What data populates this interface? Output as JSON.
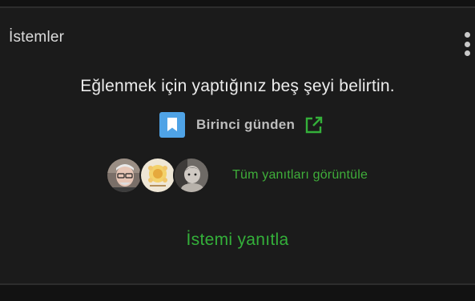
{
  "section": {
    "title": "İstemler"
  },
  "prompt": {
    "text": "Eğlenmek için yaptığınız beş şeyi belirtin.",
    "source_label": "Birinci günden"
  },
  "responses": {
    "view_all_label": "Tüm yanıtları görüntüle",
    "avatars": [
      "avatar-man-glasses",
      "avatar-flower-drawing",
      "avatar-baby-photo"
    ]
  },
  "actions": {
    "reply_label": "İstemi yanıtla"
  },
  "colors": {
    "background": "#121212",
    "card": "#1b1b1b",
    "accent_green": "#34b03a",
    "bookmark_blue": "#4fa3e6"
  },
  "icons": {
    "more": "more-vert-icon",
    "bookmark": "bookmark-icon",
    "external": "external-link-icon"
  }
}
